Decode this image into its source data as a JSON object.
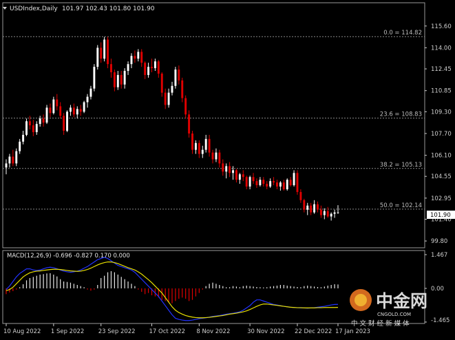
{
  "header": {
    "symbol": "USDIndex,Daily",
    "ohlc": "101.97 102.43 101.80 101.90"
  },
  "macd": {
    "label": "MACD(12,26,9) -0.696 -0.827 0.170 0.000",
    "axis_labels": [
      "1.467",
      "0.00",
      "-1.465"
    ],
    "range": [
      -1.465,
      1.467
    ]
  },
  "fibonacci": [
    {
      "label": "0.0 = 114.82",
      "value": 114.82
    },
    {
      "label": "23.6 = 108.83",
      "value": 108.83
    },
    {
      "label": "38.2 = 105.13",
      "value": 105.13
    },
    {
      "label": "50.0 = 102.14",
      "value": 102.14
    }
  ],
  "price_axis": {
    "labels": [
      "115.60",
      "114.00",
      "112.45",
      "110.85",
      "109.30",
      "107.70",
      "106.10",
      "104.55",
      "102.95",
      "101.40",
      "99.80"
    ],
    "current_price": "101.90"
  },
  "time_axis": {
    "labels": [
      "10 Aug 2022",
      "1 Sep 2022",
      "23 Sep 2022",
      "17 Oct 2022",
      "8 Nov 2022",
      "30 Nov 2022",
      "22 Dec 2022",
      "17 Jan 2023"
    ]
  },
  "watermark": {
    "name": "中金网",
    "domain": "CNGOLD.COM",
    "tagline": "中 文 财 经 新 媒 体"
  },
  "colors": {
    "background": "#000000",
    "bull": "#ffffff",
    "bear": "#e00000",
    "macd_line": "#2233ff",
    "signal_line": "#e8e000",
    "fib": "#8a8a8a",
    "axis": "#cfcfcf"
  },
  "chart_data": {
    "type": "candlestick",
    "title": "USDIndex,Daily",
    "ylim": [
      99.3,
      116.5
    ],
    "y_ticks": [
      115.6,
      114.0,
      112.45,
      110.85,
      109.3,
      107.7,
      106.1,
      104.55,
      102.95,
      101.4,
      99.8
    ],
    "x_labels": [
      "10 Aug 2022",
      "1 Sep 2022",
      "23 Sep 2022",
      "17 Oct 2022",
      "8 Nov 2022",
      "30 Nov 2022",
      "22 Dec 2022",
      "17 Jan 2023"
    ],
    "candles": [
      [
        105.2,
        105.8,
        104.7,
        105.5
      ],
      [
        105.5,
        106.2,
        105.2,
        106.0
      ],
      [
        106.0,
        106.5,
        105.3,
        105.5
      ],
      [
        105.5,
        106.6,
        105.3,
        106.4
      ],
      [
        106.4,
        107.3,
        106.2,
        107.1
      ],
      [
        107.1,
        107.9,
        106.9,
        107.6
      ],
      [
        107.6,
        108.8,
        107.5,
        108.6
      ],
      [
        108.6,
        109.0,
        108.0,
        108.3
      ],
      [
        108.3,
        108.7,
        107.5,
        107.8
      ],
      [
        107.8,
        108.6,
        107.6,
        108.4
      ],
      [
        108.4,
        109.0,
        108.2,
        108.8
      ],
      [
        108.8,
        109.1,
        108.2,
        108.5
      ],
      [
        108.5,
        109.8,
        108.4,
        109.6
      ],
      [
        109.6,
        109.9,
        108.9,
        109.2
      ],
      [
        109.2,
        110.4,
        109.1,
        110.2
      ],
      [
        110.2,
        110.6,
        109.4,
        109.7
      ],
      [
        109.7,
        110.0,
        108.8,
        109.0
      ],
      [
        109.0,
        109.2,
        107.6,
        107.9
      ],
      [
        107.9,
        109.4,
        107.8,
        109.3
      ],
      [
        109.3,
        109.8,
        109.0,
        109.6
      ],
      [
        109.6,
        109.9,
        108.9,
        109.1
      ],
      [
        109.1,
        109.7,
        108.8,
        109.5
      ],
      [
        109.5,
        109.8,
        109.0,
        109.3
      ],
      [
        109.3,
        110.1,
        109.2,
        110.0
      ],
      [
        110.0,
        110.6,
        109.6,
        110.4
      ],
      [
        110.4,
        111.2,
        110.2,
        111.0
      ],
      [
        111.0,
        112.8,
        110.8,
        112.6
      ],
      [
        112.6,
        114.2,
        112.4,
        114.0
      ],
      [
        114.0,
        114.4,
        112.9,
        113.2
      ],
      [
        113.2,
        114.8,
        113.0,
        114.6
      ],
      [
        114.6,
        114.8,
        112.5,
        112.8
      ],
      [
        112.8,
        113.2,
        111.8,
        112.2
      ],
      [
        112.2,
        112.4,
        110.8,
        111.1
      ],
      [
        111.1,
        112.3,
        110.9,
        112.0
      ],
      [
        112.0,
        112.3,
        111.0,
        111.3
      ],
      [
        111.3,
        112.5,
        111.0,
        112.3
      ],
      [
        112.3,
        113.0,
        112.0,
        112.8
      ],
      [
        112.8,
        113.6,
        112.5,
        113.4
      ],
      [
        113.4,
        113.8,
        112.9,
        113.2
      ],
      [
        113.2,
        113.9,
        113.0,
        113.7
      ],
      [
        113.7,
        113.9,
        112.6,
        112.9
      ],
      [
        112.9,
        113.0,
        111.7,
        112.0
      ],
      [
        112.0,
        112.9,
        111.8,
        112.6
      ],
      [
        112.6,
        113.2,
        112.2,
        112.5
      ],
      [
        112.5,
        113.2,
        112.3,
        113.0
      ],
      [
        113.0,
        113.1,
        111.8,
        112.1
      ],
      [
        112.1,
        112.2,
        110.4,
        110.7
      ],
      [
        110.7,
        111.0,
        109.5,
        109.8
      ],
      [
        109.8,
        111.0,
        109.6,
        110.7
      ],
      [
        110.7,
        111.5,
        110.5,
        111.2
      ],
      [
        111.2,
        112.6,
        111.0,
        112.4
      ],
      [
        112.4,
        112.7,
        111.3,
        111.6
      ],
      [
        111.6,
        111.8,
        110.0,
        110.3
      ],
      [
        110.3,
        110.5,
        108.8,
        109.1
      ],
      [
        109.1,
        109.4,
        107.4,
        107.7
      ],
      [
        107.7,
        107.9,
        106.2,
        106.5
      ],
      [
        106.5,
        107.2,
        106.2,
        107.0
      ],
      [
        107.0,
        107.2,
        105.9,
        106.2
      ],
      [
        106.2,
        106.8,
        105.9,
        106.5
      ],
      [
        106.5,
        107.6,
        106.3,
        107.3
      ],
      [
        107.3,
        107.6,
        106.0,
        106.3
      ],
      [
        106.3,
        106.5,
        105.5,
        105.8
      ],
      [
        105.8,
        106.6,
        105.6,
        106.3
      ],
      [
        106.3,
        106.5,
        105.2,
        105.5
      ],
      [
        105.5,
        105.8,
        104.6,
        104.9
      ],
      [
        104.9,
        105.5,
        104.4,
        105.3
      ],
      [
        105.3,
        105.6,
        104.5,
        104.8
      ],
      [
        104.8,
        105.3,
        104.3,
        105.0
      ],
      [
        105.0,
        105.1,
        104.1,
        104.3
      ],
      [
        104.3,
        104.8,
        104.0,
        104.7
      ],
      [
        104.7,
        105.0,
        104.2,
        104.5
      ],
      [
        104.5,
        104.6,
        103.6,
        103.8
      ],
      [
        103.8,
        104.6,
        103.6,
        104.5
      ],
      [
        104.5,
        104.8,
        104.0,
        104.2
      ],
      [
        104.2,
        104.4,
        103.7,
        103.9
      ],
      [
        103.9,
        104.5,
        103.8,
        104.3
      ],
      [
        104.3,
        104.5,
        103.8,
        104.0
      ],
      [
        104.0,
        104.2,
        103.6,
        103.8
      ],
      [
        103.8,
        104.4,
        103.7,
        104.2
      ],
      [
        104.2,
        104.5,
        103.9,
        104.1
      ],
      [
        104.1,
        104.3,
        103.6,
        103.8
      ],
      [
        103.8,
        104.2,
        103.5,
        104.1
      ],
      [
        104.1,
        104.3,
        103.5,
        103.6
      ],
      [
        103.6,
        104.4,
        103.5,
        104.3
      ],
      [
        104.3,
        104.5,
        103.8,
        103.9
      ],
      [
        103.9,
        105.0,
        103.8,
        104.8
      ],
      [
        104.8,
        105.0,
        103.2,
        103.4
      ],
      [
        103.4,
        103.6,
        102.6,
        102.8
      ],
      [
        102.8,
        102.9,
        101.9,
        102.1
      ],
      [
        102.1,
        102.6,
        101.7,
        102.4
      ],
      [
        102.4,
        102.6,
        101.7,
        101.9
      ],
      [
        101.9,
        102.8,
        101.8,
        102.5
      ],
      [
        102.5,
        102.7,
        101.9,
        102.1
      ],
      [
        102.1,
        102.4,
        101.5,
        101.7
      ],
      [
        101.7,
        102.2,
        101.4,
        102.0
      ],
      [
        102.0,
        102.3,
        101.5,
        101.6
      ],
      [
        101.6,
        101.9,
        101.3,
        101.8
      ],
      [
        101.8,
        102.1,
        101.5,
        101.9
      ],
      [
        101.9,
        102.43,
        101.8,
        101.9
      ]
    ],
    "macd_histogram": [
      -0.25,
      -0.18,
      -0.12,
      -0.05,
      0.05,
      0.18,
      0.35,
      0.45,
      0.5,
      0.55,
      0.6,
      0.62,
      0.65,
      0.66,
      0.6,
      0.52,
      0.4,
      0.3,
      0.28,
      0.25,
      0.2,
      0.15,
      0.1,
      0.05,
      -0.05,
      -0.1,
      -0.05,
      0.15,
      0.45,
      0.55,
      0.7,
      0.75,
      0.7,
      0.6,
      0.5,
      0.4,
      0.3,
      0.2,
      0.1,
      -0.05,
      -0.15,
      -0.25,
      -0.2,
      -0.3,
      -0.35,
      -0.4,
      -0.5,
      -0.55,
      -0.6,
      -0.65,
      -0.55,
      -0.45,
      -0.4,
      -0.45,
      -0.55,
      -0.5,
      -0.35,
      -0.2,
      -0.05,
      0.1,
      0.2,
      0.25,
      0.2,
      0.15,
      0.1,
      0.05,
      0.05,
      0.1,
      0.08,
      0.05,
      0.1,
      0.12,
      0.1,
      0.08,
      0.06,
      0.05,
      0.04,
      0.05,
      0.08,
      0.1,
      0.12,
      0.15,
      0.15,
      0.12,
      0.1,
      0.08,
      0.06,
      0.05,
      0.1,
      0.12,
      0.1,
      0.08,
      0.06,
      0.05,
      0.08,
      0.12,
      0.15,
      0.18,
      0.17
    ],
    "macd_line": [
      -0.05,
      0.1,
      0.3,
      0.5,
      0.65,
      0.75,
      0.85,
      0.85,
      0.8,
      0.78,
      0.8,
      0.85,
      0.9,
      0.92,
      0.9,
      0.85,
      0.8,
      0.75,
      0.72,
      0.7,
      0.72,
      0.75,
      0.8,
      0.88,
      0.95,
      1.05,
      1.15,
      1.25,
      1.3,
      1.35,
      1.3,
      1.2,
      1.1,
      1.0,
      0.95,
      0.9,
      0.85,
      0.8,
      0.7,
      0.55,
      0.4,
      0.25,
      0.1,
      -0.05,
      -0.2,
      -0.35,
      -0.55,
      -0.75,
      -0.95,
      -1.15,
      -1.3,
      -1.35,
      -1.38,
      -1.4,
      -1.4,
      -1.38,
      -1.35,
      -1.32,
      -1.3,
      -1.28,
      -1.25,
      -1.22,
      -1.2,
      -1.18,
      -1.15,
      -1.12,
      -1.1,
      -1.08,
      -1.05,
      -1.02,
      -0.95,
      -0.85,
      -0.75,
      -0.6,
      -0.5,
      -0.5,
      -0.55,
      -0.6,
      -0.65,
      -0.7,
      -0.72,
      -0.75,
      -0.78,
      -0.8,
      -0.82,
      -0.83,
      -0.84,
      -0.85,
      -0.85,
      -0.86,
      -0.85,
      -0.84,
      -0.82,
      -0.8,
      -0.78,
      -0.75,
      -0.72,
      -0.7,
      -0.696
    ],
    "signal_line": [
      -0.1,
      -0.05,
      0.05,
      0.2,
      0.35,
      0.5,
      0.6,
      0.68,
      0.72,
      0.75,
      0.76,
      0.78,
      0.8,
      0.82,
      0.83,
      0.83,
      0.82,
      0.8,
      0.78,
      0.76,
      0.75,
      0.74,
      0.75,
      0.78,
      0.82,
      0.88,
      0.95,
      1.02,
      1.08,
      1.12,
      1.15,
      1.15,
      1.12,
      1.08,
      1.02,
      0.96,
      0.9,
      0.85,
      0.8,
      0.72,
      0.62,
      0.5,
      0.38,
      0.25,
      0.1,
      -0.05,
      -0.2,
      -0.4,
      -0.6,
      -0.8,
      -0.95,
      -1.05,
      -1.12,
      -1.18,
      -1.22,
      -1.25,
      -1.27,
      -1.28,
      -1.28,
      -1.27,
      -1.26,
      -1.24,
      -1.22,
      -1.2,
      -1.18,
      -1.15,
      -1.12,
      -1.1,
      -1.08,
      -1.05,
      -1.02,
      -0.98,
      -0.92,
      -0.85,
      -0.78,
      -0.72,
      -0.68,
      -0.68,
      -0.7,
      -0.72,
      -0.74,
      -0.76,
      -0.78,
      -0.8,
      -0.82,
      -0.83,
      -0.84,
      -0.84,
      -0.85,
      -0.85,
      -0.85,
      -0.85,
      -0.84,
      -0.84,
      -0.83,
      -0.83,
      -0.83,
      -0.83,
      -0.827
    ]
  }
}
